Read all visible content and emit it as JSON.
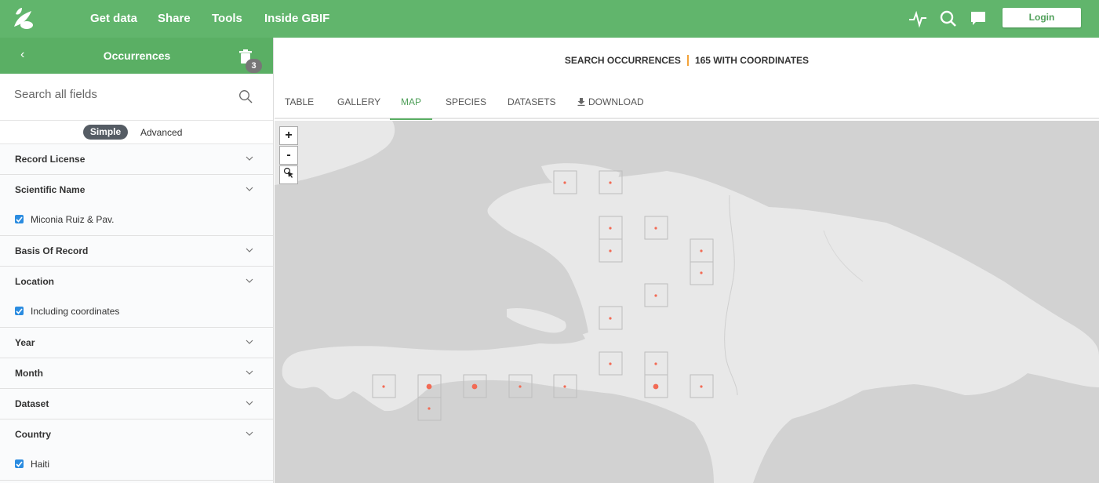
{
  "nav": {
    "links": [
      "Get data",
      "Share",
      "Tools",
      "Inside GBIF"
    ],
    "login_label": "Login"
  },
  "sidebar": {
    "title": "Occurrences",
    "trash_count": "3",
    "search_placeholder": "Search all fields",
    "mode_simple": "Simple",
    "mode_advanced": "Advanced",
    "filters": [
      {
        "label": "Record License"
      },
      {
        "label": "Scientific Name",
        "selected": "Miconia Ruiz & Pav."
      },
      {
        "label": "Basis Of Record"
      },
      {
        "label": "Location",
        "selected": "Including coordinates"
      },
      {
        "label": "Year"
      },
      {
        "label": "Month"
      },
      {
        "label": "Dataset"
      },
      {
        "label": "Country",
        "selected": "Haiti"
      }
    ]
  },
  "header": {
    "search_label": "SEARCH OCCURRENCES",
    "count_label": "165 WITH COORDINATES"
  },
  "tabs": [
    "TABLE",
    "GALLERY",
    "MAP",
    "SPECIES",
    "DATASETS",
    "DOWNLOAD"
  ],
  "active_tab": "MAP",
  "map": {
    "zoom_in": "+",
    "zoom_out": "-",
    "water_color": "#d2d2d2",
    "land_color": "#e8e8e8",
    "marker_color": "#f26b55"
  },
  "colors": {
    "brand_green": "#61b56c",
    "sidebar_header": "#5aaf64",
    "accent_orange": "#f3a33a",
    "checkbox_blue": "#2b8ce0"
  }
}
